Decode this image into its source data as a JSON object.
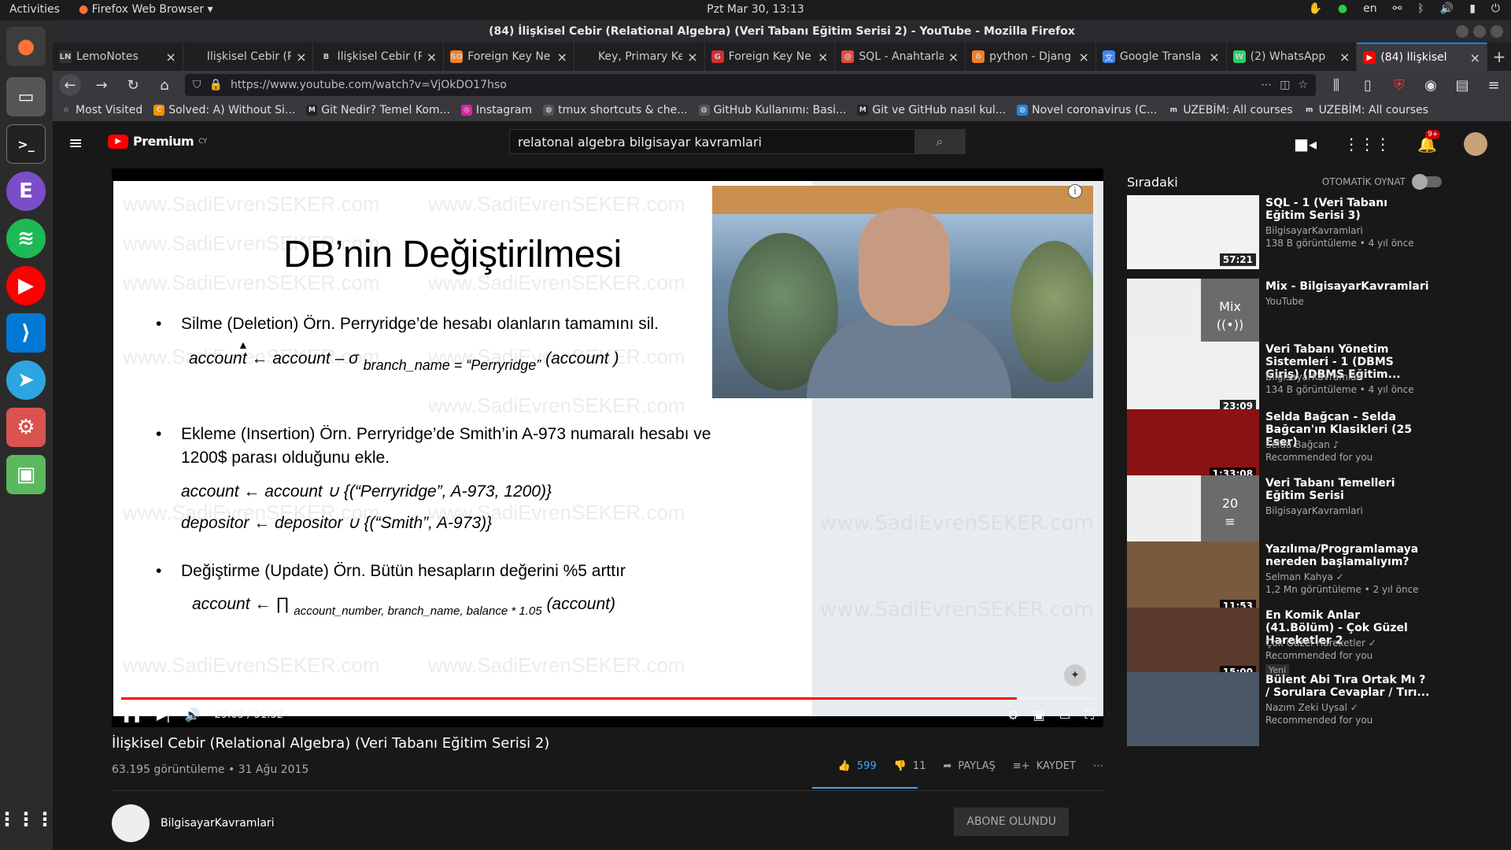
{
  "os": {
    "activities": "Activities",
    "app_menu": "Firefox Web Browser",
    "clock": "Pzt Mar 30, 13:13",
    "lang": "en"
  },
  "window": {
    "title": "(84) İlişkisel Cebir (Relational Algebra) (Veri Tabanı Eğitim Serisi 2) - YouTube - Mozilla Firefox"
  },
  "tabs": [
    {
      "label": "LemoNotes",
      "icon": "LN",
      "color": "#333333"
    },
    {
      "label": "İlişkisel Cebir (Rela",
      "icon": "",
      "color": "#1f1f22"
    },
    {
      "label": "İlişkisel Cebir (R",
      "icon": "B",
      "color": "#1f1f22"
    },
    {
      "label": "Foreign Key Ne",
      "icon": "SO",
      "color": "#f48024"
    },
    {
      "label": "Key, Primary Key, U",
      "icon": "",
      "color": "#1f1f22"
    },
    {
      "label": "Foreign Key Ne",
      "icon": "G",
      "color": "#d32f2f"
    },
    {
      "label": "SQL - Anahtarla",
      "icon": "@",
      "color": "#e04b3d"
    },
    {
      "label": "python - Djang",
      "icon": "δ",
      "color": "#f48024"
    },
    {
      "label": "Google Transla",
      "icon": "文",
      "color": "#4285f4"
    },
    {
      "label": "(2) WhatsApp",
      "icon": "W",
      "color": "#25d366"
    },
    {
      "label": "(84) İlişkisel",
      "icon": "▶",
      "color": "#ff0000"
    }
  ],
  "nav": {
    "url": "https://www.youtube.com/watch?v=VjOkDO17hso"
  },
  "bookmarks": [
    {
      "label": "Most Visited",
      "icon": "☆",
      "color": "#38383d"
    },
    {
      "label": "Solved: A) Without Si...",
      "icon": "C",
      "color": "#f39200"
    },
    {
      "label": "Git Nedir? Temel Kom...",
      "icon": "M",
      "color": "#222222"
    },
    {
      "label": "Instagram",
      "icon": "◎",
      "color": "#d6249f"
    },
    {
      "label": "tmux shortcuts & che...",
      "icon": "◍",
      "color": "#555555"
    },
    {
      "label": "GitHub Kullanımı: Basi...",
      "icon": "◍",
      "color": "#555555"
    },
    {
      "label": "Git ve GitHub nasıl kul...",
      "icon": "M",
      "color": "#222222"
    },
    {
      "label": "Novel coronavirus (C...",
      "icon": "◍",
      "color": "#1e88e5"
    },
    {
      "label": "UZEBİM: All courses",
      "icon": "m",
      "color": "#38383d"
    },
    {
      "label": "UZEBİM: All courses",
      "icon": "m",
      "color": "#38383d"
    }
  ],
  "youtube": {
    "logo": "Premium",
    "logo_sup": "CY",
    "search_value": "relatonal algebra bilgisayar kavramlari",
    "notif_count": "9+"
  },
  "slide": {
    "title": "DB’nin Değiştirilmesi",
    "watermark": "www.SadiEvrenSEKER.com",
    "bullet1": "Silme (Deletion)  Örn. Perryridge’de hesabı olanların tamamını sil.",
    "formula1": "account ← account – σ",
    "formula1_sub": "branch_name = “Perryridge”",
    "formula1_end": "(account )",
    "bullet2a": "Ekleme (Insertion)  Örn. Perryridge’de Smith’in A-973 numaralı hesabı ve",
    "bullet2b": "1200$ parası olduğunu ekle.",
    "formula2": "account ←  account  ∪  {(“Perryridge”, A-973, 1200)}",
    "formula3": "depositor ←  depositor  ∪  {(“Smith”, A-973)}",
    "bullet3": "Değiştirme (Update) Örn. Bütün hesapların değerini %5 arttır",
    "formula4": "account ← ∏",
    "formula4_sub": "account_number, branch_name, balance * 1.05",
    "formula4_end": "(account)"
  },
  "player": {
    "time": "29:03 / 31:32",
    "progress_fraction": 0.921,
    "info": "i"
  },
  "video": {
    "title": "İlişkisel Cebir (Relational Algebra) (Veri Tabanı Eğitim Serisi 2)",
    "meta": "63.195 görüntüleme • 31 Ağu 2015",
    "likes": "599",
    "dislikes": "11",
    "share": "PAYLAŞ",
    "save": "KAYDET",
    "channel": "BilgisayarKavramlari",
    "subscribe": "ABONE OLUNDU"
  },
  "sidebar": {
    "next_label": "Sıradaki",
    "autoplay_label": "OTOMATİK OYNAT",
    "items": [
      {
        "title": "SQL - 1 (Veri Tabanı Eğitim Serisi 3)",
        "channel": "BilgisayarKavramlari",
        "meta": "138 B görüntüleme • 4 yıl önce",
        "duration": "57:21",
        "thumb": "#f2f2f2",
        "overlay": "",
        "overlay_icon": "",
        "badge": ""
      },
      {
        "title": "Mix - BilgisayarKavramlari",
        "channel": "YouTube",
        "meta": "",
        "duration": "",
        "thumb": "#eeeeee",
        "overlay": "Mix",
        "overlay_icon": "((•))",
        "badge": ""
      },
      {
        "title": "Veri Tabanı Yönetim Sistemleri - 1 (DBMS Giriş) (DBMS Eğitim...",
        "channel": "BilgisayarKavramlari",
        "meta": "134 B görüntüleme • 4 yıl önce",
        "duration": "23:09",
        "thumb": "#f0f0f0",
        "overlay": "",
        "overlay_icon": "",
        "badge": ""
      },
      {
        "title": "Selda Bağcan - Selda Bağcan'ın Klasikleri (25 Eser)",
        "channel": "Selda Bağcan ♪",
        "meta": "Recommended for you",
        "duration": "1:33:08",
        "thumb": "#8b1212",
        "overlay": "",
        "overlay_icon": "",
        "badge": ""
      },
      {
        "title": "Veri Tabanı Temelleri Eğitim Serisi",
        "channel": "BilgisayarKavramlari",
        "meta": "",
        "duration": "",
        "thumb": "#eeeeee",
        "overlay": "20",
        "overlay_icon": "≡",
        "badge": ""
      },
      {
        "title": "Yazılıma/Programlamaya nereden başlamalıyım?",
        "channel": "Selman Kahya ✓",
        "meta": "1,2 Mn görüntüleme • 2 yıl önce",
        "duration": "11:53",
        "thumb": "#7a5a3c",
        "overlay": "",
        "overlay_icon": "",
        "badge": ""
      },
      {
        "title": "En Komik Anlar (41.Bölüm) - Çok Güzel Hareketler 2",
        "channel": "Çok Güzel Hareketler ✓",
        "meta": "Recommended for you",
        "duration": "15:00",
        "thumb": "#5a3a2c",
        "overlay": "",
        "overlay_icon": "",
        "badge": "Yeni"
      },
      {
        "title": "Bülent Abi Tıra Ortak Mı ? / Sorulara Cevaplar / Tırı...",
        "channel": "Nazım Zeki Uysal ✓",
        "meta": "Recommended for you",
        "duration": "",
        "thumb": "#4a5868",
        "overlay": "",
        "overlay_icon": "",
        "badge": ""
      }
    ]
  }
}
